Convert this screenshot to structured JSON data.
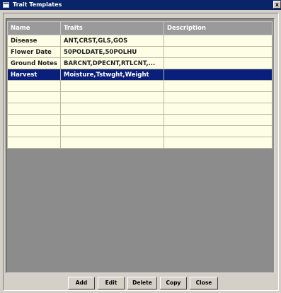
{
  "window": {
    "title": "Trait Templates",
    "close_glyph": "x"
  },
  "grid": {
    "columns": [
      "Name",
      "Traits",
      "Description"
    ],
    "rows": [
      {
        "name": "Disease",
        "traits": "ANT,CRST,GLS,GOS",
        "description": ""
      },
      {
        "name": "Flower Date",
        "traits": "50POLDATE,50POLHU",
        "description": ""
      },
      {
        "name": "Ground Notes",
        "traits": "BARCNT,DPECNT,RTLCNT,...",
        "description": ""
      },
      {
        "name": "Harvest",
        "traits": "Moisture,Tstwght,Weight",
        "description": ""
      }
    ],
    "selected_row": "Harvest",
    "empty_row_count": 6
  },
  "buttons": {
    "add": "Add",
    "edit": "Edit",
    "delete": "Delete",
    "copy": "Copy",
    "close": "Close"
  },
  "colors": {
    "titlebar": "#0a246a",
    "selection": "#0a1e7c",
    "row_background": "#fefee6",
    "header_background": "#9a9a9a",
    "panel_background": "#8c8c8c"
  }
}
